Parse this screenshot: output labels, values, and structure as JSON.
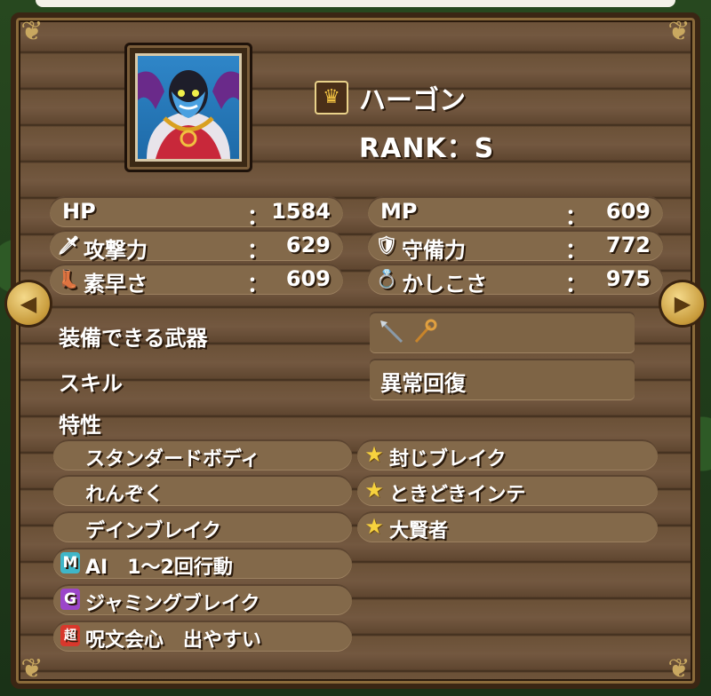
{
  "monster": {
    "name": "ハーゴン",
    "rank": "RANK：S"
  },
  "stats": [
    {
      "label": "HP",
      "colon": "：",
      "value": "1584",
      "icon": "",
      "icon_name": ""
    },
    {
      "label": "MP",
      "colon": "：",
      "value": "609",
      "icon": "",
      "icon_name": ""
    },
    {
      "label": "攻撃力",
      "colon": "：",
      "value": "629",
      "icon": "🗡",
      "icon_name": "sword-icon"
    },
    {
      "label": "守備力",
      "colon": "：",
      "value": "772",
      "icon": "🛡",
      "icon_name": "shield-icon"
    },
    {
      "label": "素早さ",
      "colon": "：",
      "value": "609",
      "icon": "👢",
      "icon_name": "boot-icon"
    },
    {
      "label": "かしこさ",
      "colon": "：",
      "value": "975",
      "icon": "💍",
      "icon_name": "ring-icon"
    }
  ],
  "equip": {
    "label": "装備できる武器",
    "weapons": [
      "spear-icon",
      "staff-icon"
    ]
  },
  "skill": {
    "label": "スキル",
    "value": "異常回復"
  },
  "traits": {
    "label": "特性",
    "left": [
      {
        "text": "スタンダードボディ",
        "badge": "",
        "badge_color": ""
      },
      {
        "text": "れんぞく",
        "badge": "",
        "badge_color": ""
      },
      {
        "text": "デインブレイク",
        "badge": "",
        "badge_color": ""
      },
      {
        "text": "AI　1～2回行動",
        "badge": "M",
        "badge_color": "#3fb6c8"
      },
      {
        "text": "ジャミングブレイク",
        "badge": "G",
        "badge_color": "#9b46c9"
      },
      {
        "text": "呪文会心　出やすい",
        "badge": "超",
        "badge_color": "#d8382c"
      }
    ],
    "right": [
      {
        "text": "封じブレイク",
        "icon": "★"
      },
      {
        "text": "ときどきインテ",
        "icon": "★"
      },
      {
        "text": "大賢者",
        "icon": "★"
      }
    ]
  },
  "nav": {
    "prev": "◀",
    "next": "▶"
  }
}
